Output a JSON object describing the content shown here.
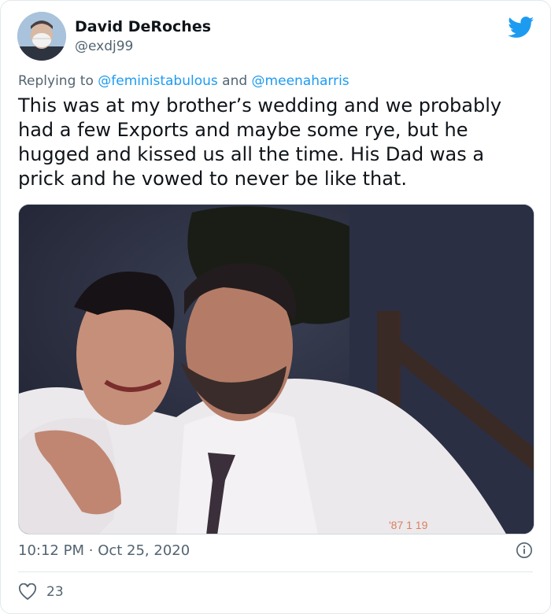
{
  "author": {
    "name": "David DeRoches",
    "handle": "@exdj99",
    "avatar_icon": "profile-avatar"
  },
  "reply": {
    "prefix": "Replying to",
    "mention1": "@feministabulous",
    "joiner": "and",
    "mention2": "@meenaharris"
  },
  "tweet_text": "This was at my brother’s wedding and we probably\nhad a few Exports and maybe some rye, but he\nhugged and kissed us all the time. His Dad was a\nprick and he vowed to never be like that.",
  "photo_stamp": "'87 1 19",
  "meta": {
    "time": "10:12 PM",
    "separator": "·",
    "date": "Oct 25, 2020"
  },
  "likes": {
    "count": "23",
    "icon": "heart-icon"
  },
  "colors": {
    "link": "#1d9bf0",
    "muted": "#536471",
    "twitter_blue": "#1d9bf0"
  }
}
